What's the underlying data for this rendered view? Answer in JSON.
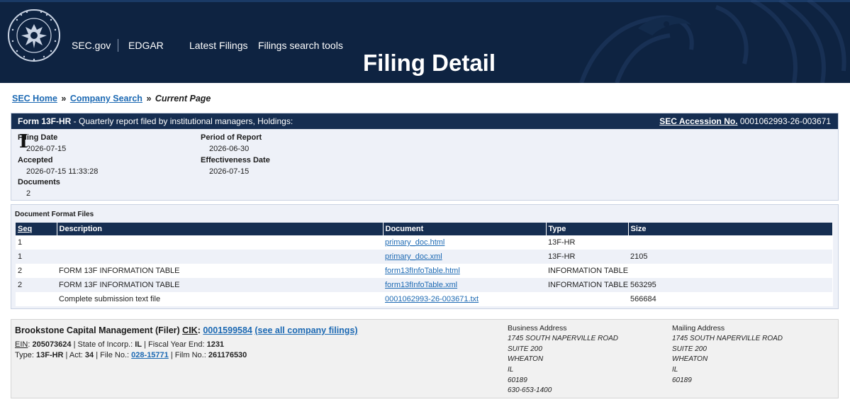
{
  "header": {
    "nav": {
      "sec_gov": "SEC.gov",
      "edgar": "EDGAR",
      "latest_filings": "Latest Filings",
      "search_tools": "Filings search tools"
    },
    "title": "Filing Detail",
    "bg_color": "#0e2341"
  },
  "breadcrumb": {
    "home": "SEC Home",
    "sep": "»",
    "company_search": "Company Search",
    "current": "Current Page"
  },
  "filing": {
    "form_type": "Form 13F-HR",
    "form_desc": " - Quarterly report filed by institutional managers, Holdings:",
    "accession_label": "SEC Accession No.",
    "accession_number": "0001062993-26-003671",
    "filing_date_label": "Filing Date",
    "filing_date": "2026-07-15",
    "accepted_label": "Accepted",
    "accepted": "2026-07-15 11:33:28",
    "documents_label": "Documents",
    "documents": "2",
    "period_label": "Period of Report",
    "period": "2026-06-30",
    "effectiveness_label": "Effectiveness Date",
    "effectiveness": "2026-07-15",
    "cursor_glyph": "I"
  },
  "documents": {
    "heading": "Document Format Files",
    "columns": {
      "seq": "Seq",
      "description": "Description",
      "document": "Document",
      "type": "Type",
      "size": "Size"
    },
    "rows": [
      {
        "seq": "1",
        "description": "",
        "document": "primary_doc.html",
        "type": "13F-HR",
        "size": ""
      },
      {
        "seq": "1",
        "description": "",
        "document": "primary_doc.xml",
        "type": "13F-HR",
        "size": "2105"
      },
      {
        "seq": "2",
        "description": "FORM 13F INFORMATION TABLE",
        "document": "form13fInfoTable.html",
        "type": "INFORMATION TABLE",
        "size": ""
      },
      {
        "seq": "2",
        "description": "FORM 13F INFORMATION TABLE",
        "document": "form13fInfoTable.xml",
        "type": "INFORMATION TABLE",
        "size": "563295"
      },
      {
        "seq": "",
        "description": "Complete submission text file",
        "document": "0001062993-26-003671.txt",
        "type": "",
        "size": "566684"
      }
    ]
  },
  "filer": {
    "name": "Brookstone Capital Management (Filer)",
    "cik_label": "CIK",
    "cik": "0001599584",
    "see_all": "(see all company filings)",
    "ein_label": "EIN",
    "ein": "205073624",
    "state_label": "State of Incorp.",
    "state": "IL",
    "fiscal_label": "Fiscal Year End",
    "fiscal": "1231",
    "type_label": "Type",
    "type": "13F-HR",
    "act_label": "Act",
    "act": "34",
    "file_label": "File No.",
    "file_no": "028-15771",
    "film_label": "Film No.",
    "film_no": "261176530",
    "business_address": {
      "title": "Business Address",
      "lines": [
        "1745 SOUTH NAPERVILLE ROAD",
        "SUITE 200",
        "WHEATON",
        "IL",
        "60189",
        "630-653-1400"
      ]
    },
    "mailing_address": {
      "title": "Mailing Address",
      "lines": [
        "1745 SOUTH NAPERVILLE ROAD",
        "SUITE 200",
        "WHEATON",
        "IL",
        "60189"
      ]
    }
  }
}
